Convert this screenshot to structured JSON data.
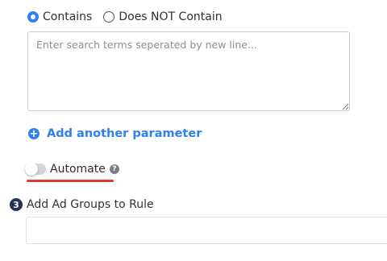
{
  "match_type": {
    "options": [
      {
        "label": "Contains",
        "selected": true
      },
      {
        "label": "Does NOT Contain",
        "selected": false
      }
    ]
  },
  "search_terms": {
    "value": "",
    "placeholder": "Enter search terms seperated by new line..."
  },
  "add_parameter": {
    "label": "Add another parameter",
    "icon": "plus-circle-icon"
  },
  "automate": {
    "label": "Automate",
    "enabled": false,
    "help_icon": "question-circle-icon",
    "help_glyph": "?"
  },
  "section3": {
    "step": "3",
    "title": "Add Ad Groups to Rule",
    "input_value": ""
  },
  "colors": {
    "accent": "#2f80ed",
    "underline_mark": "#e23b2e",
    "step_badge": "#1f3556"
  }
}
